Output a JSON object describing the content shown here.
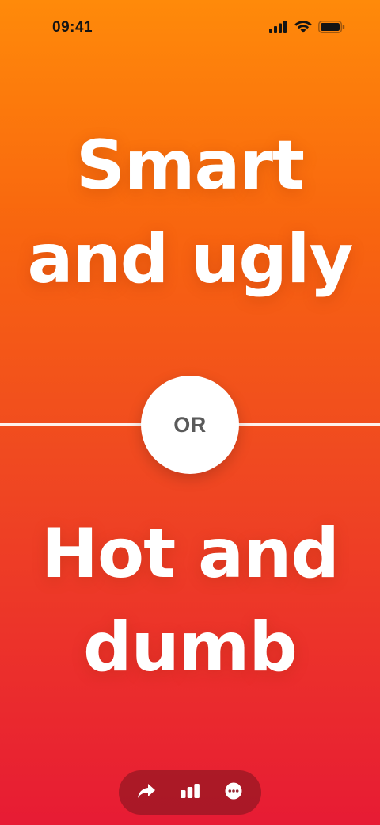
{
  "status_bar": {
    "time": "09:41",
    "icons": [
      "signal-icon",
      "wifi-icon",
      "battery-icon"
    ]
  },
  "question": {
    "option_a": {
      "line1": "Smart",
      "line2": "and ugly"
    },
    "separator": "OR",
    "option_b": {
      "line1": "Hot and",
      "line2": "dumb"
    }
  },
  "toolbar": {
    "buttons": [
      "share-icon",
      "stats-icon",
      "more-icon"
    ]
  },
  "colors": {
    "gradient_top": "#ff8a0a",
    "gradient_bottom": "#e71b34",
    "text": "#ffffff",
    "separator_text": "#5a5a5a"
  }
}
